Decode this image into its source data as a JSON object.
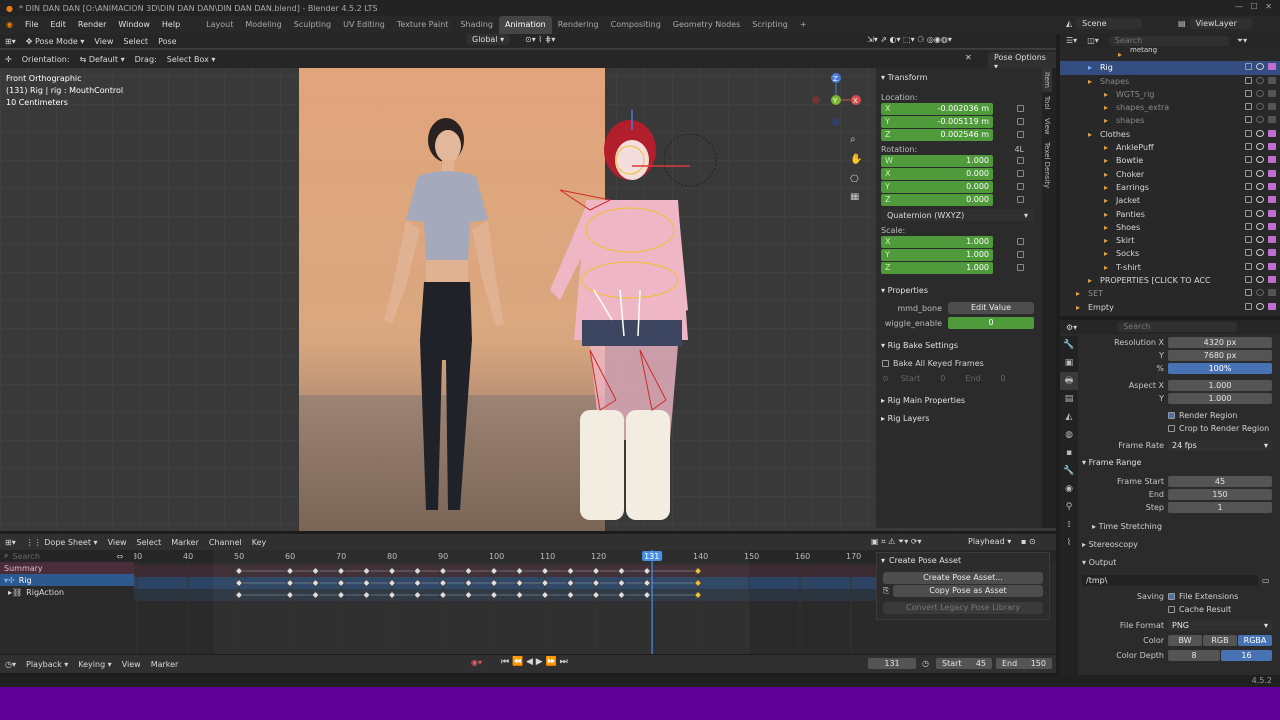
{
  "title": "* DIN DAN DAN [O:\\ANIMACION 3D\\DIN DAN DAN\\DIN DAN DAN.blend] - Blender 4.5.2 LTS",
  "menu": [
    "File",
    "Edit",
    "Render",
    "Window",
    "Help"
  ],
  "workspaces": [
    "Layout",
    "Modeling",
    "Sculpting",
    "UV Editing",
    "Texture Paint",
    "Shading",
    "Animation",
    "Rendering",
    "Compositing",
    "Geometry Nodes",
    "Scripting"
  ],
  "active_workspace": "Animation",
  "scene": "Scene",
  "view_layer": "ViewLayer",
  "viewport": {
    "mode": "Pose Mode",
    "menus": [
      "View",
      "Select",
      "Pose"
    ],
    "transform_orientation": "Global",
    "orientation_label": "Orientation:",
    "orientation_value": "Default",
    "drag_label": "Drag:",
    "drag_value": "Select Box",
    "pose_options": "Pose Options",
    "overlay_lines": [
      "Front Orthographic",
      "(131) Rig | rig : MouthControl",
      "10 Centimeters"
    ]
  },
  "npanel": {
    "transform": "Transform",
    "location_label": "Location:",
    "location": [
      {
        "axis": "X",
        "value": "-0.002036 m"
      },
      {
        "axis": "Y",
        "value": "-0.005119 m"
      },
      {
        "axis": "Z",
        "value": "0.002546 m"
      }
    ],
    "rotation_label": "Rotation:",
    "rotation_mode_short": "4L",
    "rotation": [
      {
        "axis": "W",
        "value": "1.000"
      },
      {
        "axis": "X",
        "value": "0.000"
      },
      {
        "axis": "Y",
        "value": "0.000"
      },
      {
        "axis": "Z",
        "value": "0.000"
      }
    ],
    "rotation_mode": "Quaternion (WXYZ)",
    "scale_label": "Scale:",
    "scale": [
      {
        "axis": "X",
        "value": "1.000"
      },
      {
        "axis": "Y",
        "value": "1.000"
      },
      {
        "axis": "Z",
        "value": "1.000"
      }
    ],
    "properties": "Properties",
    "mmd_bone": "mmd_bone",
    "edit_value": "Edit Value",
    "wiggle_enable": "wiggle_enable",
    "wiggle_value": "0",
    "rig_bake": "Rig Bake Settings",
    "bake_all": "Bake All Keyed Frames",
    "start": "Start",
    "start_val": "0",
    "end": "End",
    "end_val": "0",
    "rig_main": "Rig Main Properties",
    "rig_layers": "Rig Layers",
    "tabs": [
      "Item",
      "Tool",
      "View",
      "Texel Density"
    ]
  },
  "outliner": {
    "search_placeholder": "Search",
    "rows": [
      {
        "label": "metang",
        "indent": 70,
        "cut": true
      },
      {
        "label": "Rig",
        "indent": 40,
        "sel": true
      },
      {
        "label": "Shapes",
        "indent": 40,
        "dim": true
      },
      {
        "label": "WGTS_rig",
        "indent": 56,
        "dim": true
      },
      {
        "label": "shapes_extra",
        "indent": 56,
        "dim": true
      },
      {
        "label": "shapes",
        "indent": 56,
        "dim": true
      },
      {
        "label": "Clothes",
        "indent": 40
      },
      {
        "label": "AnklePuff",
        "indent": 56
      },
      {
        "label": "Bowtie",
        "indent": 56
      },
      {
        "label": "Choker",
        "indent": 56
      },
      {
        "label": "Earrings",
        "indent": 56
      },
      {
        "label": "Jacket",
        "indent": 56
      },
      {
        "label": "Panties",
        "indent": 56
      },
      {
        "label": "Shoes",
        "indent": 56
      },
      {
        "label": "Skirt",
        "indent": 56
      },
      {
        "label": "Socks",
        "indent": 56
      },
      {
        "label": "T-shirt",
        "indent": 56
      },
      {
        "label": "PROPERTIES [CLICK TO ACC",
        "indent": 40
      },
      {
        "label": "SET",
        "indent": 28,
        "dim": true
      },
      {
        "label": "Empty",
        "indent": 28
      }
    ]
  },
  "props": {
    "search_placeholder": "Search",
    "res_x_label": "Resolution X",
    "res_x": "4320 px",
    "res_y_label": "Y",
    "res_y": "7680 px",
    "pct_label": "%",
    "pct": "100%",
    "aspect_x_label": "Aspect X",
    "aspect_x": "1.000",
    "aspect_y_label": "Y",
    "aspect_y": "1.000",
    "render_region": "Render Region",
    "crop_region": "Crop to Render Region",
    "frame_rate_label": "Frame Rate",
    "frame_rate": "24 fps",
    "frame_range": "Frame Range",
    "frame_start_label": "Frame Start",
    "frame_start": "45",
    "end_label": "End",
    "end": "150",
    "step_label": "Step",
    "step": "1",
    "time_stretching": "Time Stretching",
    "stereoscopy": "Stereoscopy",
    "output": "Output",
    "output_path": "/tmp\\",
    "saving_label": "Saving",
    "file_ext": "File Extensions",
    "cache_result": "Cache Result",
    "file_format_label": "File Format",
    "file_format": "PNG",
    "color_label": "Color",
    "color_opts": [
      "BW",
      "RGB",
      "RGBA"
    ],
    "color_depth_label": "Color Depth",
    "color_depth": [
      "8",
      "16"
    ],
    "version": "4.5.2"
  },
  "dopesheet": {
    "editor": "Dope Sheet",
    "menus": [
      "View",
      "Select",
      "Marker",
      "Channel",
      "Key"
    ],
    "playhead_label": "Playhead",
    "search_placeholder": "Search",
    "channels": [
      "Summary",
      "Rig",
      "RigAction"
    ],
    "ticks": [
      "30",
      "40",
      "50",
      "60",
      "70",
      "80",
      "90",
      "100",
      "110",
      "120",
      "131",
      "140",
      "150",
      "160",
      "170"
    ],
    "current_frame": "131",
    "keys": [
      50,
      60,
      65,
      70,
      75,
      80,
      85,
      90,
      95,
      100,
      105,
      110,
      115,
      120,
      125,
      130,
      140
    ],
    "pose_panel_title": "Create Pose Asset",
    "create_pose": "Create Pose Asset...",
    "copy_pose": "Copy Pose as Asset",
    "convert_legacy": "Convert Legacy Pose Library"
  },
  "timeline": {
    "menus": [
      "Playback",
      "Keying",
      "View",
      "Marker"
    ],
    "frame": "131",
    "start_label": "Start",
    "start": "45",
    "end_label": "End",
    "end": "150"
  }
}
